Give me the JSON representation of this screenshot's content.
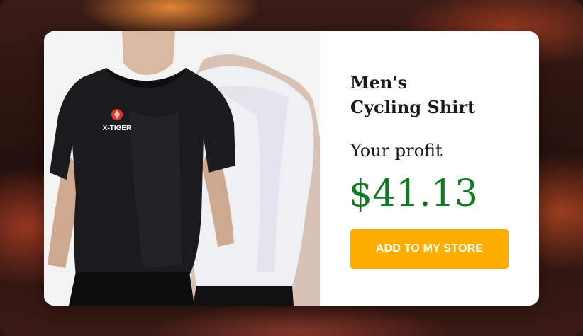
{
  "product": {
    "title_line1": "Men's",
    "title_line2": "Cycling Shirt",
    "profit_label": "Your profit",
    "profit_value": "$41.13",
    "cta_label": "ADD TO MY STORE",
    "image_brand_text": "X-TIGER"
  },
  "colors": {
    "price": "#0f7a22",
    "cta_background": "#ffae00",
    "cta_text": "#ffffff"
  }
}
